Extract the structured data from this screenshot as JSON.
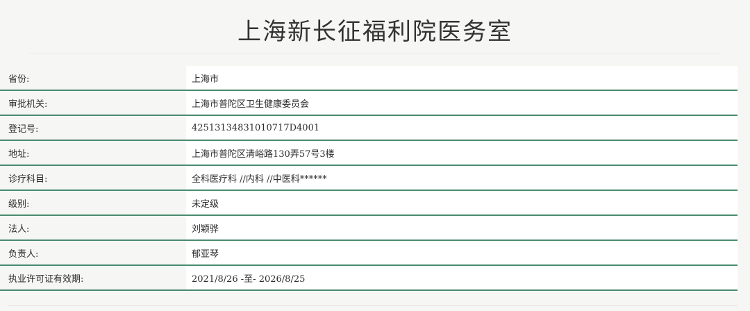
{
  "header": {
    "title": "上海新长征福利院医务室"
  },
  "info": {
    "rows": [
      {
        "label": "省份:",
        "value": "上海市"
      },
      {
        "label": "审批机关:",
        "value": "上海市普陀区卫生健康委员会"
      },
      {
        "label": "登记号:",
        "value": "42513134831010717D4001"
      },
      {
        "label": "地址:",
        "value": "上海市普陀区清峪路130弄57号3楼"
      },
      {
        "label": "诊疗科目:",
        "value": "全科医疗科 //内科 //中医科******"
      },
      {
        "label": "级别:",
        "value": "未定级"
      },
      {
        "label": "法人:",
        "value": "刘颖骅"
      },
      {
        "label": "负责人:",
        "value": "郁亚琴"
      },
      {
        "label": "执业许可证有效期:",
        "value": "2021/8/26 -至- 2026/8/25"
      }
    ]
  },
  "colors": {
    "row_border": "#4a8a6e",
    "background": "#f6f6f4",
    "value_background": "#ffffff"
  }
}
